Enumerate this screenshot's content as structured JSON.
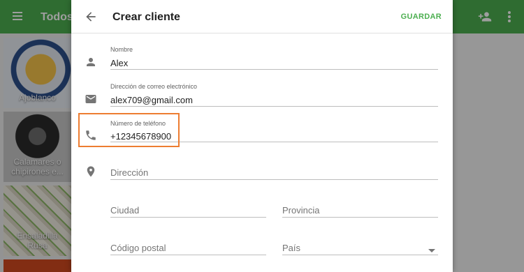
{
  "background": {
    "title": "Todos",
    "recipes": [
      {
        "label": "Ajoblanco"
      },
      {
        "label": "Calamares o chipirones e..."
      },
      {
        "label": "Ensaladilla Rusa"
      }
    ],
    "icons": [
      "menu-icon",
      "add-person-icon",
      "more-vert-icon"
    ],
    "accent_color": "#4caf50"
  },
  "dialog": {
    "title": "Crear cliente",
    "save_label": "GUARDAR",
    "fields": {
      "name": {
        "label": "Nombre",
        "value": "Alex"
      },
      "email": {
        "label": "Dirección de correo electrónico",
        "value": "alex709@gmail.com"
      },
      "phone": {
        "label": "Número de teléfono",
        "value": "+12345678900"
      },
      "address": {
        "placeholder": "Dirección"
      },
      "city": {
        "placeholder": "Ciudad"
      },
      "province": {
        "placeholder": "Provincia"
      },
      "postal_code": {
        "placeholder": "Código postal"
      },
      "country": {
        "placeholder": "País"
      }
    },
    "highlight_color": "#ed7d31"
  }
}
